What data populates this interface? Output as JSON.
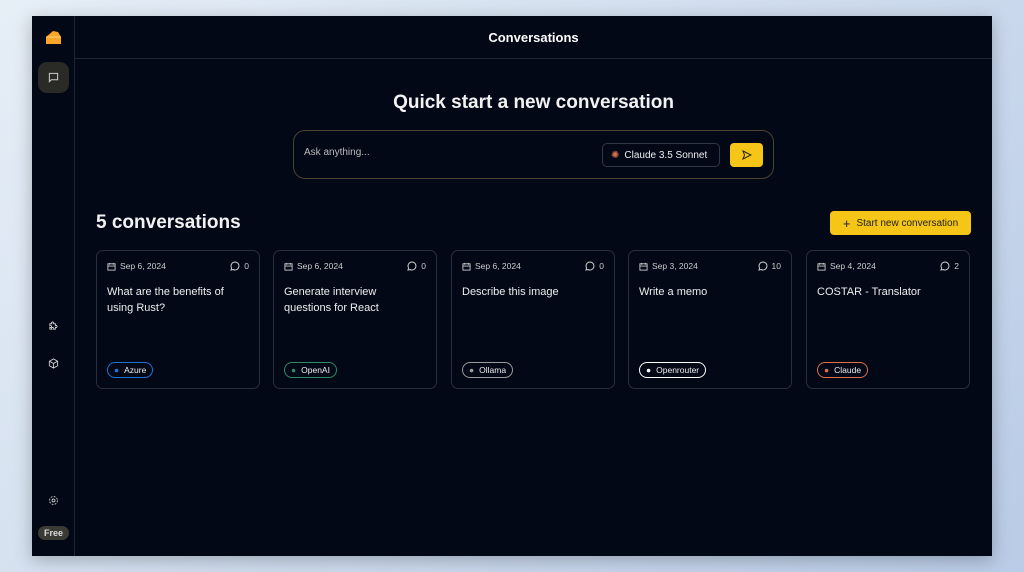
{
  "sidebar": {
    "plan_badge": "Free"
  },
  "header": {
    "title": "Conversations"
  },
  "quick_start": {
    "heading": "Quick start a new conversation",
    "placeholder": "Ask anything...",
    "model": "Claude 3.5 Sonnet"
  },
  "conversations": {
    "count_label": "5 conversations",
    "new_button": "Start new conversation",
    "items": [
      {
        "date": "Sep 6, 2024",
        "messages": "0",
        "title": "What are the benefits of using Rust?",
        "provider": "Azure",
        "color": "#1d74d8"
      },
      {
        "date": "Sep 6, 2024",
        "messages": "0",
        "title": "Generate interview questions for React",
        "provider": "OpenAI",
        "color": "#2f8a66"
      },
      {
        "date": "Sep 6, 2024",
        "messages": "0",
        "title": "Describe this image",
        "provider": "Ollama",
        "color": "#9a9a9a"
      },
      {
        "date": "Sep 3, 2024",
        "messages": "10",
        "title": "Write a memo",
        "provider": "Openrouter",
        "color": "#ffffff"
      },
      {
        "date": "Sep 4, 2024",
        "messages": "2",
        "title": "COSTAR - Translator",
        "provider": "Claude",
        "color": "#d9714a"
      }
    ]
  },
  "colors": {
    "accent": "#f5c518",
    "bg": "#030816"
  }
}
